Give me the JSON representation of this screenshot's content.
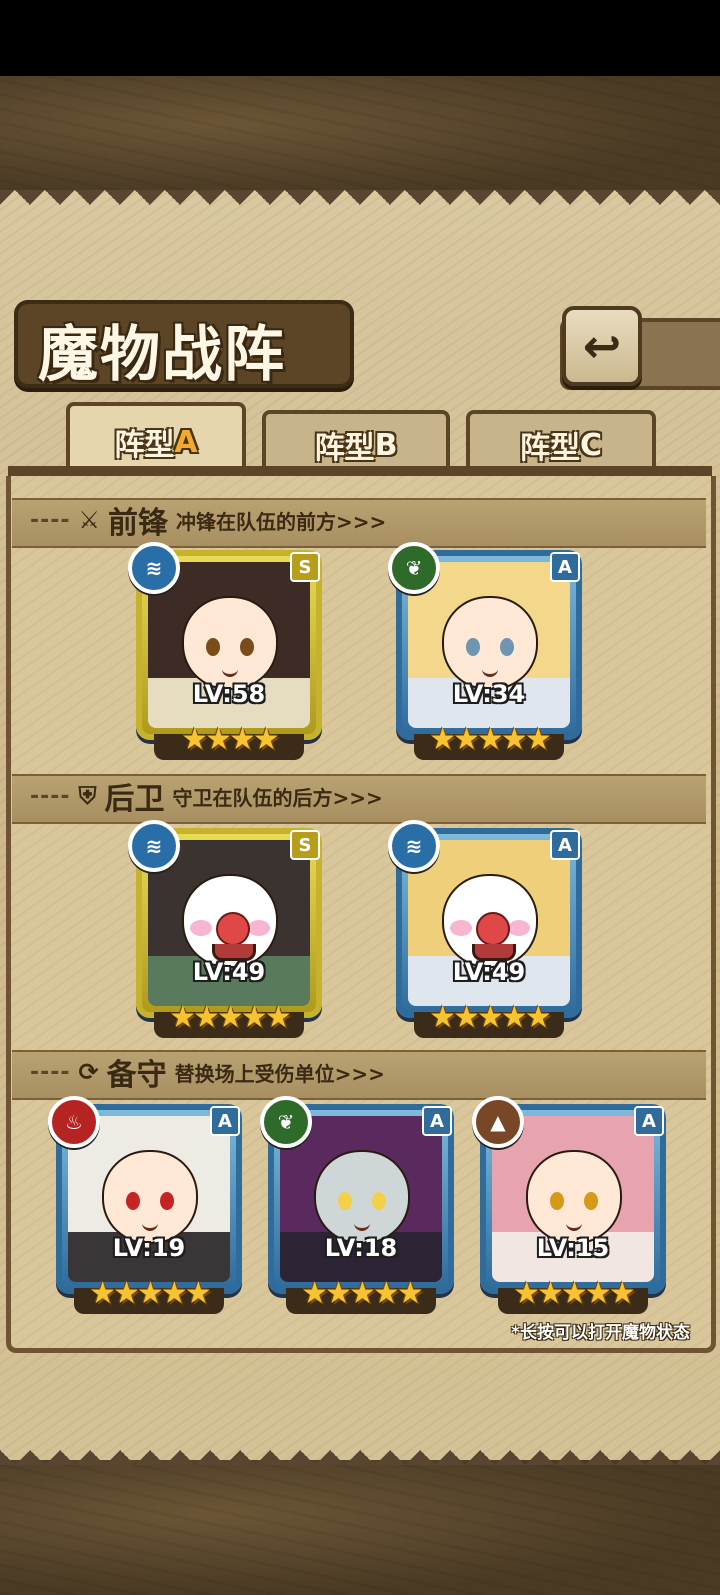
{
  "screen": {
    "title": "魔物战阵",
    "back_icon": "return-arrow-icon"
  },
  "tabs": [
    {
      "label": "阵型",
      "suffix": "A",
      "selected": true
    },
    {
      "label": "阵型",
      "suffix": "B",
      "selected": false
    },
    {
      "label": "阵型",
      "suffix": "C",
      "selected": false
    }
  ],
  "sections": {
    "front": {
      "name": "前锋",
      "desc": "冲锋在队伍的前方>>>",
      "icon": "sword-icon",
      "dash": "----"
    },
    "rear": {
      "name": "后卫",
      "desc": "守卫在队伍的后方>>>",
      "icon": "shield-icon",
      "dash": "----"
    },
    "reserve": {
      "name": "备守",
      "desc": "替换场上受伤单位>>>",
      "icon": "swap-icon",
      "dash": "----"
    }
  },
  "cards": {
    "front_1": {
      "rank": "S",
      "element": "water",
      "level": "LV:58",
      "stars": 4
    },
    "front_2": {
      "rank": "A",
      "element": "leaf",
      "level": "LV:34",
      "stars": 5
    },
    "rear_1": {
      "rank": "S",
      "element": "water",
      "level": "LV:49",
      "stars": 5
    },
    "rear_2": {
      "rank": "A",
      "element": "water",
      "level": "LV:49",
      "stars": 5
    },
    "reserve_1": {
      "rank": "A",
      "element": "fire",
      "level": "LV:19",
      "stars": 5
    },
    "reserve_2": {
      "rank": "A",
      "element": "leaf",
      "level": "LV:18",
      "stars": 5
    },
    "reserve_3": {
      "rank": "A",
      "element": "earth",
      "level": "LV:15",
      "stars": 5
    }
  },
  "glyphs": {
    "water": "≋",
    "leaf": "❦",
    "fire": "♨",
    "earth": "▲",
    "star": "★"
  },
  "hint": "*长按可以打开魔物状态",
  "colors": {
    "rank_s": "#c7b22c",
    "rank_a": "#2f6c9c",
    "panel": "#d9c69b",
    "frame": "#5b4526"
  }
}
